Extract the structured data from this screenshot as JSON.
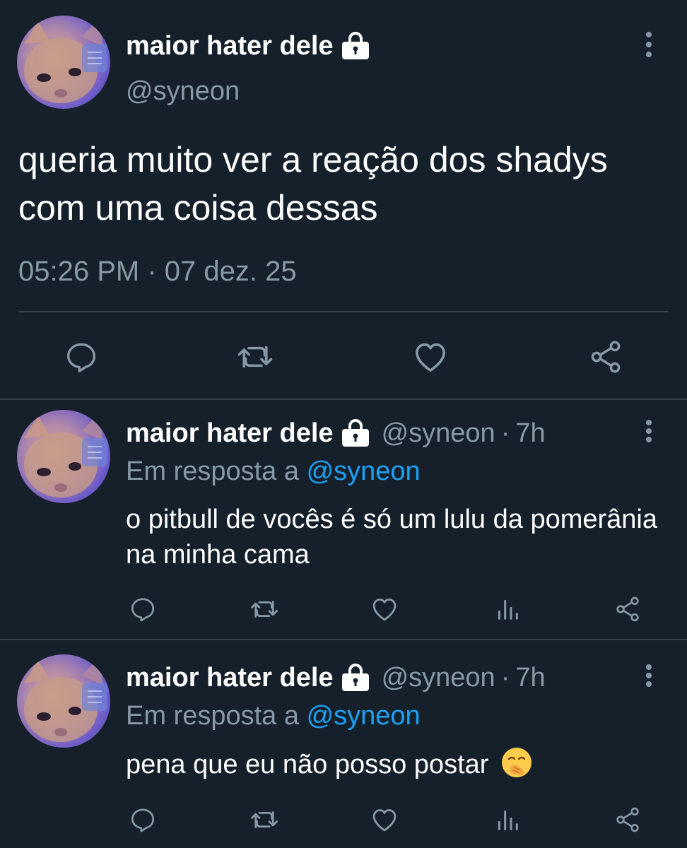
{
  "main_tweet": {
    "name": "maior hater dele",
    "handle": "@syneon",
    "text": "queria muito ver a reação dos shadys com uma coisa dessas",
    "timestamp": "05:26 PM · 07 dez. 25",
    "icons": [
      "reply-icon",
      "retweet-icon",
      "like-icon",
      "share-icon"
    ]
  },
  "replies": [
    {
      "name": "maior hater dele",
      "handle": "@syneon",
      "dot": "·",
      "time": "7h",
      "reply_prefix": "Em resposta a",
      "reply_mention": "@syneon",
      "text": "o pitbull de vocês é só um lulu da pomerânia na minha cama",
      "icons": [
        "reply-icon",
        "retweet-icon",
        "like-icon",
        "analytics-icon",
        "share-icon"
      ]
    },
    {
      "name": "maior hater dele",
      "handle": "@syneon",
      "dot": "·",
      "time": "7h",
      "reply_prefix": "Em resposta a",
      "reply_mention": "@syneon",
      "text": "pena que eu não posso postar",
      "emoji": "face-with-hand-over-mouth",
      "icons": [
        "reply-icon",
        "retweet-icon",
        "like-icon",
        "analytics-icon",
        "share-icon"
      ]
    }
  ],
  "colors": {
    "background": "#15202b",
    "primary_text": "#ffffff",
    "secondary_text": "#8899a6",
    "link": "#1da1f2",
    "divider": "#38444d"
  }
}
